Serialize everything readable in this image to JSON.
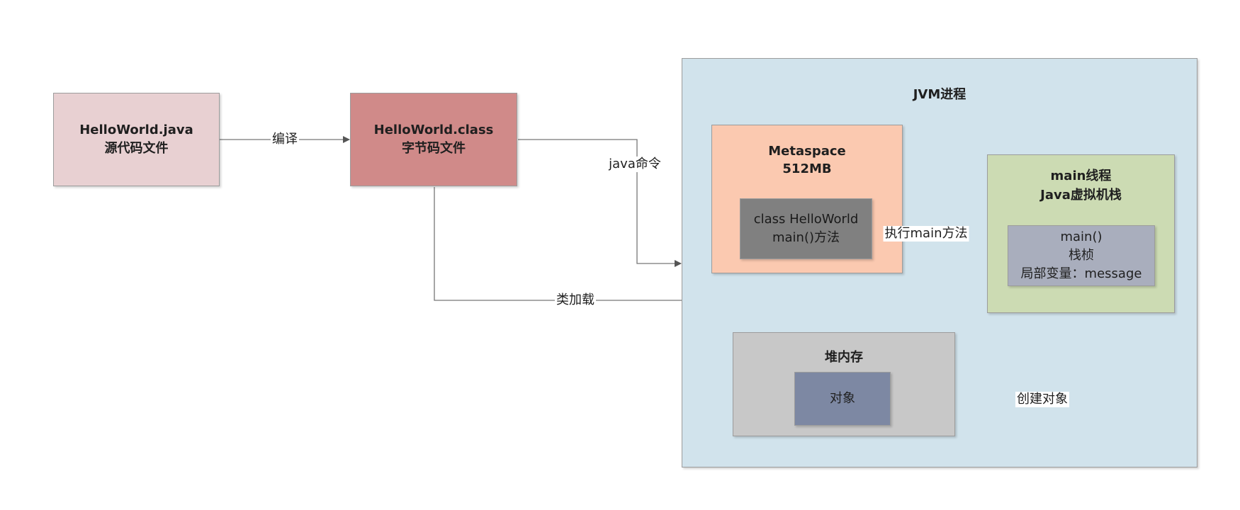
{
  "nodes": {
    "source_file": {
      "line1": "HelloWorld.java",
      "line2": "源代码文件",
      "color": "#e8d0d2"
    },
    "class_file": {
      "line1": "HelloWorld.class",
      "line2": "字节码文件",
      "color": "#d08a89"
    },
    "jvm": {
      "title": "JVM进程",
      "color": "#d1e3ec"
    },
    "metaspace": {
      "line1": "Metaspace",
      "line2": "512MB",
      "color": "#fbc9b0"
    },
    "class_info": {
      "line1": "class HelloWorld",
      "line2": "main()方法",
      "color": "#808080"
    },
    "main_thread": {
      "line1": "main线程",
      "line2": "Java虚拟机栈",
      "color": "#ccdbb3"
    },
    "stack_frame": {
      "line1": "main()",
      "line2": "栈桢",
      "line3": "局部变量：message",
      "color": "#a9aebd"
    },
    "heap": {
      "title": "堆内存",
      "color": "#c8c8c8"
    },
    "object": {
      "label": "对象",
      "color": "#7d88a3"
    }
  },
  "edges": {
    "compile": "编译",
    "java_command": "java命令",
    "class_loading": "类加载",
    "execute_main": "执行main方法",
    "create_object": "创建对象"
  }
}
